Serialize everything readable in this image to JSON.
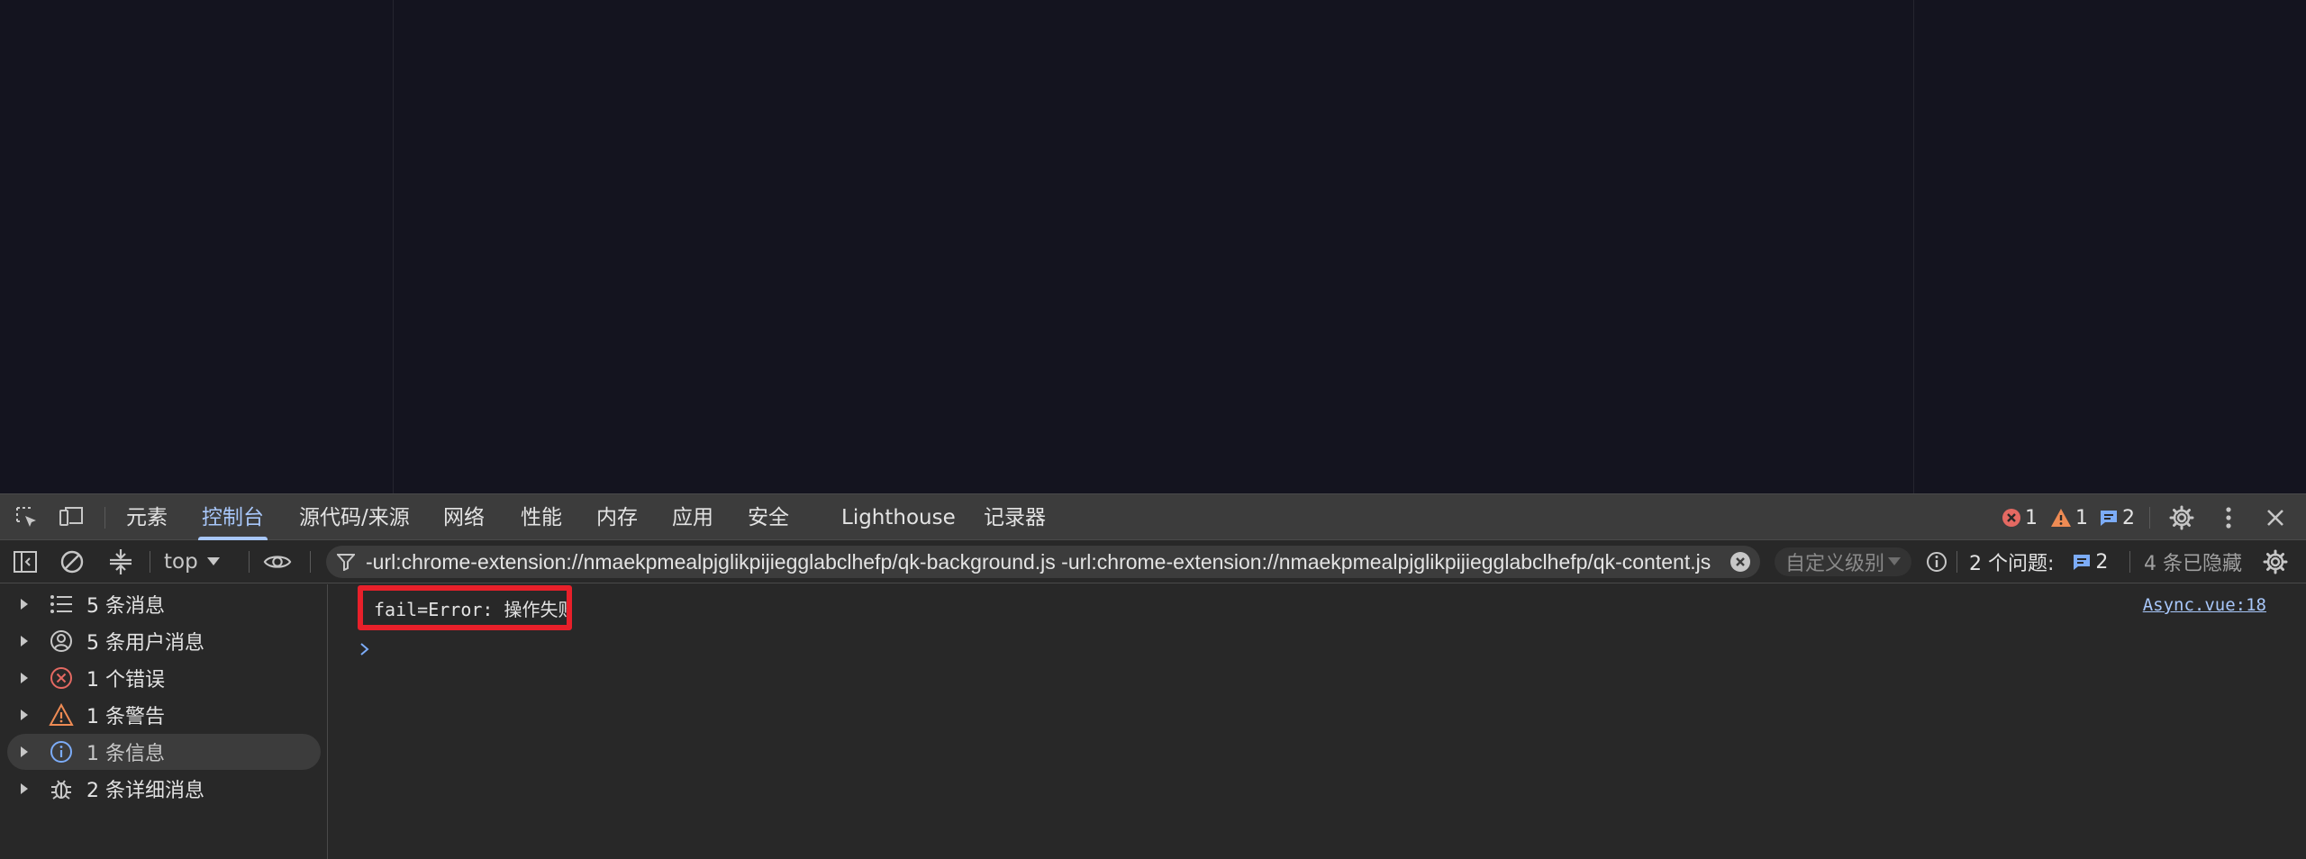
{
  "tabs": [
    {
      "label": "元素",
      "active": false
    },
    {
      "label": "控制台",
      "active": true
    },
    {
      "label": "源代码/来源",
      "active": false
    },
    {
      "label": "网络",
      "active": false
    },
    {
      "label": "性能",
      "active": false
    },
    {
      "label": "内存",
      "active": false
    },
    {
      "label": "应用",
      "active": false
    },
    {
      "label": "安全",
      "active": false
    },
    {
      "label": "Lighthouse",
      "active": false
    },
    {
      "label": "记录器",
      "active": false
    }
  ],
  "counters": {
    "errors": "1",
    "warnings": "1",
    "messages": "2"
  },
  "toolbar": {
    "context": "top",
    "filter_value": "-url:chrome-extension://nmaekpmealpjglikpijiegglabclhefp/qk-background.js -url:chrome-extension://nmaekpmealpjglikpijiegglabclhefp/qk-content.js",
    "levels_label": "自定义级别",
    "issues_label": "2 个问题:",
    "issues_count": "2",
    "hidden_label": "4 条已隐藏"
  },
  "sidebar": {
    "items": [
      {
        "label": "5 条消息",
        "icon": "list-icon"
      },
      {
        "label": "5 条用户消息",
        "icon": "user-icon"
      },
      {
        "label": "1 个错误",
        "icon": "error-icon"
      },
      {
        "label": "1 条警告",
        "icon": "warning-icon"
      },
      {
        "label": "1 条信息",
        "icon": "info-icon",
        "selected": true
      },
      {
        "label": "2 条详细消息",
        "icon": "bug-icon"
      }
    ]
  },
  "console": {
    "message": "fail=Error: 操作失败",
    "source": "Async.vue:18"
  },
  "colors": {
    "accent": "#a8c7fa",
    "error": "#e46962",
    "warning": "#ee8b54",
    "highlight": "#e8202a"
  }
}
